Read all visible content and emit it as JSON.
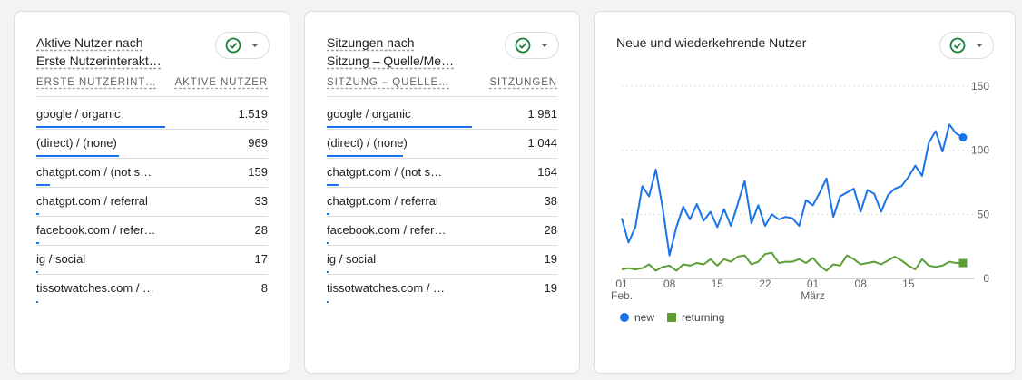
{
  "card1": {
    "title_line1": "Aktive Nutzer nach",
    "title_line2": "Erste Nutzerinterakt…",
    "col_left": "ERSTE NUTZERINT…",
    "col_right": "AKTIVE NUTZER",
    "rows": [
      {
        "label": "google / organic",
        "value": "1.519",
        "share": 1.0
      },
      {
        "label": "(direct) / (none)",
        "value": "969",
        "share": 0.638
      },
      {
        "label": "chatgpt.com / (not s…",
        "value": "159",
        "share": 0.105
      },
      {
        "label": "chatgpt.com / referral",
        "value": "33",
        "share": 0.022
      },
      {
        "label": "facebook.com / refer…",
        "value": "28",
        "share": 0.018
      },
      {
        "label": "ig / social",
        "value": "17",
        "share": 0.011
      },
      {
        "label": "tissotwatches.com / …",
        "value": "8",
        "share": 0.005
      }
    ]
  },
  "card2": {
    "title_line1": "Sitzungen nach",
    "title_line2": "Sitzung – Quelle/Me…",
    "col_left": "SITZUNG – QUELLE…",
    "col_right": "SITZUNGEN",
    "rows": [
      {
        "label": "google / organic",
        "value": "1.981",
        "share": 1.0
      },
      {
        "label": "(direct) / (none)",
        "value": "1.044",
        "share": 0.527
      },
      {
        "label": "chatgpt.com / (not s…",
        "value": "164",
        "share": 0.083
      },
      {
        "label": "chatgpt.com / referral",
        "value": "38",
        "share": 0.019
      },
      {
        "label": "facebook.com / refer…",
        "value": "28",
        "share": 0.014
      },
      {
        "label": "ig / social",
        "value": "19",
        "share": 0.01
      },
      {
        "label": "tissotwatches.com / …",
        "value": "19",
        "share": 0.01
      }
    ]
  },
  "card3": {
    "title": "Neue und wiederkehrende Nutzer",
    "legend_new": "new",
    "legend_returning": "returning"
  },
  "colors": {
    "accent": "#1a73e8",
    "returning": "#5b9f35",
    "check": "#188038"
  },
  "icons": [
    "check-circle-icon",
    "caret-down-icon"
  ],
  "chart_data": {
    "type": "line",
    "title": "Neue und wiederkehrende Nutzer",
    "x_tick_labels": [
      "01",
      "08",
      "15",
      "22",
      "01",
      "08",
      "15"
    ],
    "x_tick_sublabels": [
      "Feb.",
      "",
      "",
      "",
      "März",
      "",
      ""
    ],
    "y_ticks": [
      0,
      50,
      100,
      150
    ],
    "ylim": [
      0,
      150
    ],
    "y_axis_side": "right",
    "grid": true,
    "legend_position": "bottom-left",
    "series": [
      {
        "name": "new",
        "color": "#1a73e8",
        "values": [
          47,
          28,
          40,
          72,
          64,
          85,
          55,
          18,
          40,
          56,
          46,
          58,
          45,
          52,
          40,
          54,
          41,
          58,
          76,
          43,
          57,
          41,
          50,
          46,
          48,
          47,
          41,
          61,
          57,
          67,
          78,
          48,
          64,
          67,
          70,
          52,
          69,
          66,
          52,
          65,
          70,
          72,
          79,
          88,
          80,
          106,
          115,
          99,
          120,
          113,
          110
        ]
      },
      {
        "name": "returning",
        "color": "#5b9f35",
        "values": [
          7,
          8,
          7,
          8,
          11,
          6,
          9,
          10,
          6,
          11,
          10,
          12,
          11,
          15,
          10,
          15,
          13,
          17,
          18,
          11,
          13,
          19,
          20,
          12,
          13,
          13,
          15,
          12,
          16,
          10,
          6,
          11,
          10,
          18,
          15,
          11,
          12,
          13,
          11,
          14,
          17,
          14,
          10,
          7,
          15,
          10,
          9,
          10,
          13,
          12,
          12
        ]
      }
    ]
  }
}
